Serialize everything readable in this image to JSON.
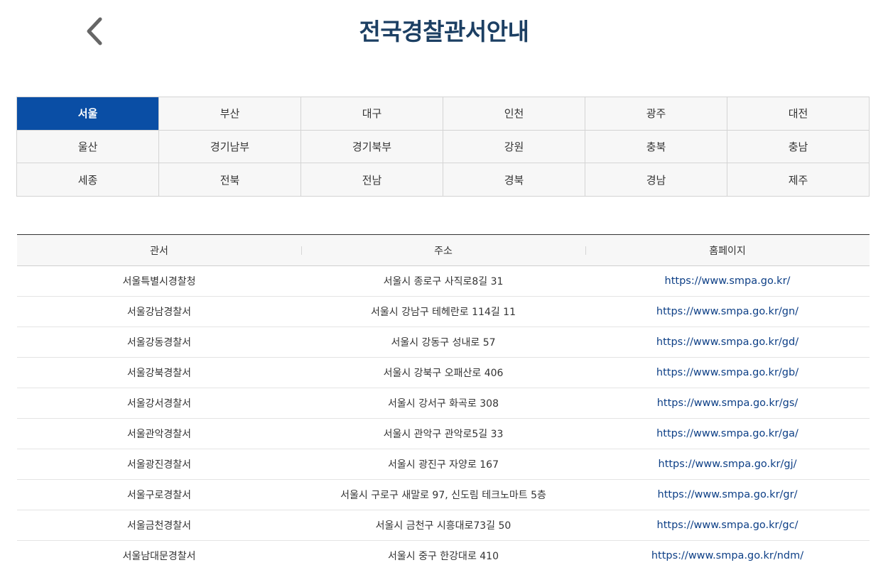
{
  "header": {
    "title": "전국경찰관서안내"
  },
  "regions": [
    "서울",
    "부산",
    "대구",
    "인천",
    "광주",
    "대전",
    "울산",
    "경기남부",
    "경기북부",
    "강원",
    "충북",
    "충남",
    "세종",
    "전북",
    "전남",
    "경북",
    "경남",
    "제주"
  ],
  "active_region_index": 0,
  "table": {
    "columns": [
      "관서",
      "주소",
      "홈페이지"
    ],
    "rows": [
      [
        "서울특별시경찰청",
        "서울시 종로구 사직로8길 31",
        "https://www.smpa.go.kr/"
      ],
      [
        "서울강남경찰서",
        "서울시 강남구 테헤란로 114길 11",
        "https://www.smpa.go.kr/gn/"
      ],
      [
        "서울강동경찰서",
        "서울시 강동구 성내로 57",
        "https://www.smpa.go.kr/gd/"
      ],
      [
        "서울강북경찰서",
        "서울시 강북구 오패산로 406",
        "https://www.smpa.go.kr/gb/"
      ],
      [
        "서울강서경찰서",
        "서울시 강서구 화곡로 308",
        "https://www.smpa.go.kr/gs/"
      ],
      [
        "서울관악경찰서",
        "서울시 관악구 관악로5길 33",
        "https://www.smpa.go.kr/ga/"
      ],
      [
        "서울광진경찰서",
        "서울시 광진구 자양로 167",
        "https://www.smpa.go.kr/gj/"
      ],
      [
        "서울구로경찰서",
        "서울시 구로구 새말로 97, 신도림 테크노마트 5층",
        "https://www.smpa.go.kr/gr/"
      ],
      [
        "서울금천경찰서",
        "서울시 금천구 시흥대로73길 50",
        "https://www.smpa.go.kr/gc/"
      ],
      [
        "서울남대문경찰서",
        "서울시 중구 한강대로 410",
        "https://www.smpa.go.kr/ndm/"
      ]
    ]
  },
  "colors": {
    "accent": "#0a4ea5",
    "title": "#1c3f63",
    "link": "#0d3f86"
  },
  "icons": {
    "back": "chevron-left-icon"
  }
}
